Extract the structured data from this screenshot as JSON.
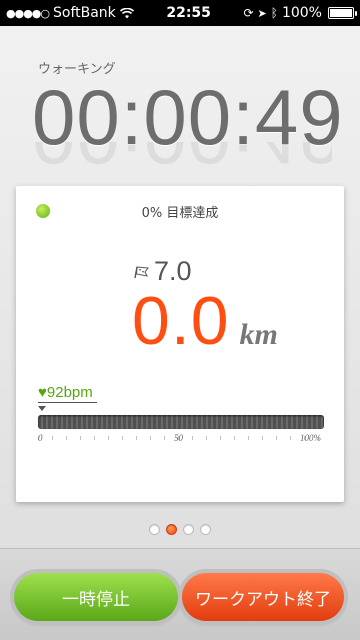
{
  "status_bar": {
    "carrier": "SoftBank",
    "time": "22:55",
    "battery": "100%",
    "battery_level": 1.0
  },
  "workout": {
    "mode": "ウォーキング",
    "elapsed": "00:00:49"
  },
  "card": {
    "goal_text": "0% 目標達成",
    "target_value": "7.0",
    "distance_value": "0.0",
    "distance_unit": "km",
    "heart_rate": "♥92bpm",
    "progress_fraction": 0.0,
    "scale": {
      "start": "0",
      "mid": "50",
      "end": "100%"
    }
  },
  "pager": {
    "count": 4,
    "active_index": 1
  },
  "buttons": {
    "pause": "一時停止",
    "end": "ワークアウト終了"
  },
  "colors": {
    "accent": "#ff4e12",
    "green": "#5aa512"
  }
}
